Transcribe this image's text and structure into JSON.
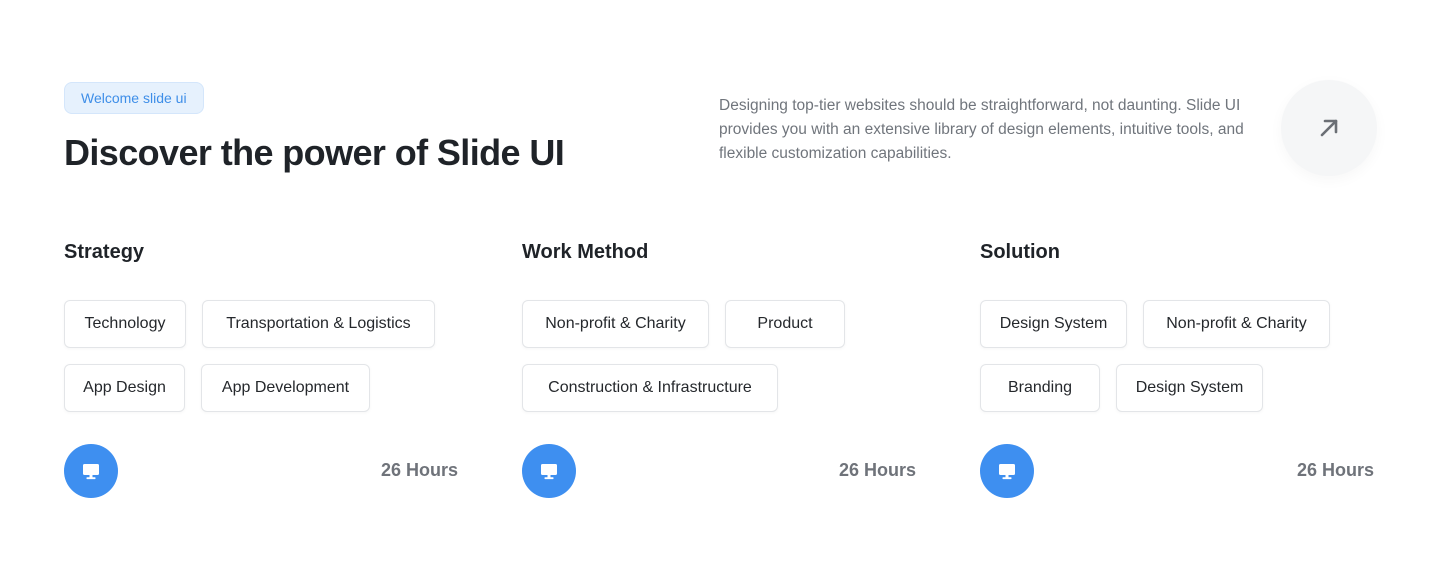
{
  "header": {
    "badge": "Welcome slide ui",
    "title": "Discover the power of Slide UI",
    "description": "Designing top-tier websites should be straightforward, not daunting. Slide UI provides you with an extensive library of design elements, intuitive tools, and flexible customization capabilities.",
    "arrow_icon": "arrow-up-right-icon"
  },
  "columns": [
    {
      "title": "Strategy",
      "tags": [
        "Technology",
        "Transportation & Logistics",
        "App Design",
        "App Development"
      ],
      "icon": "monitor-icon",
      "hours": "26 Hours"
    },
    {
      "title": "Work Method",
      "tags": [
        "Non-profit & Charity",
        "Product",
        "Construction & Infrastructure"
      ],
      "icon": "monitor-icon",
      "hours": "26 Hours"
    },
    {
      "title": "Solution",
      "tags": [
        "Design System",
        "Non-profit & Charity",
        "Branding",
        "Design System"
      ],
      "icon": "monitor-icon",
      "hours": "26 Hours"
    }
  ],
  "colors": {
    "accent": "#3e8ff0",
    "badge_bg": "#e6f1fd",
    "badge_text": "#3e8ee8",
    "heading": "#1f2328",
    "muted": "#70757c"
  }
}
